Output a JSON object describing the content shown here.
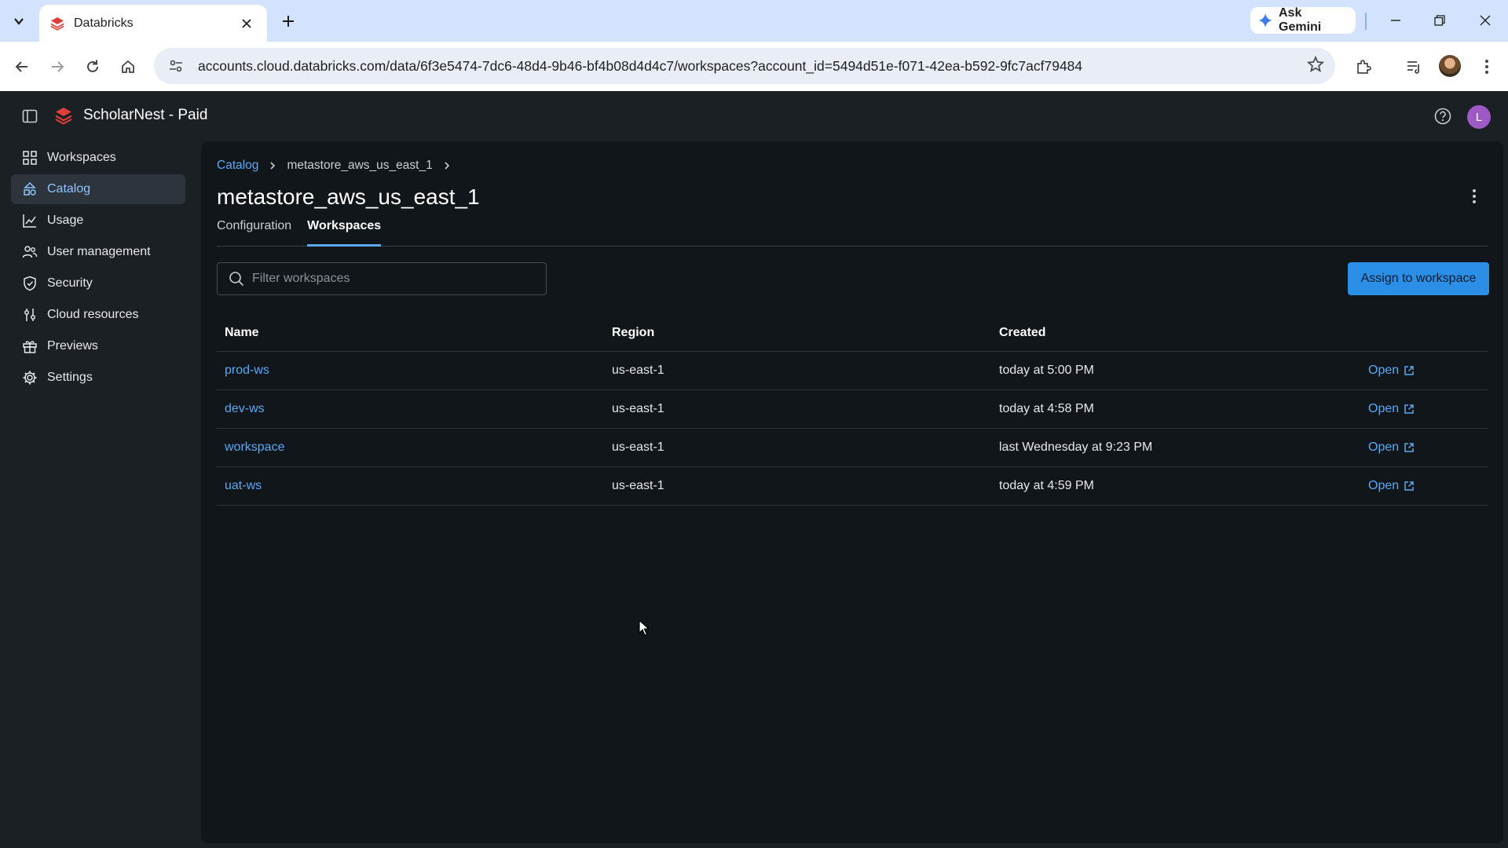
{
  "browser": {
    "tab_title": "Databricks",
    "gemini_label": "Ask Gemini",
    "url": "accounts.cloud.databricks.com/data/6f3e5474-7dc6-48d4-9b46-bf4b08d4d4c7/workspaces?account_id=5494d51e-f071-42ea-b592-9fc7acf79484"
  },
  "app": {
    "account_title": "ScholarNest - Paid",
    "avatar_letter": "L",
    "accent_color": "#5aa8f5",
    "brand_color": "#e0403a"
  },
  "sidebar": {
    "items": [
      {
        "label": "Workspaces",
        "icon": "workspaces-icon"
      },
      {
        "label": "Catalog",
        "icon": "catalog-icon",
        "active": true
      },
      {
        "label": "Usage",
        "icon": "chart-icon"
      },
      {
        "label": "User management",
        "icon": "users-icon"
      },
      {
        "label": "Security",
        "icon": "shield-icon"
      },
      {
        "label": "Cloud resources",
        "icon": "sliders-icon"
      },
      {
        "label": "Previews",
        "icon": "gift-icon"
      },
      {
        "label": "Settings",
        "icon": "gear-icon"
      }
    ]
  },
  "breadcrumb": {
    "root": "Catalog",
    "current": "metastore_aws_us_east_1"
  },
  "page": {
    "title": "metastore_aws_us_east_1",
    "tabs": [
      "Configuration",
      "Workspaces"
    ],
    "active_tab": "Workspaces"
  },
  "filter": {
    "placeholder": "Filter workspaces"
  },
  "assign_button": "Assign to workspace",
  "table": {
    "headers": [
      "Name",
      "Region",
      "Created"
    ],
    "open_label": "Open",
    "rows": [
      {
        "name": "prod-ws",
        "region": "us-east-1",
        "created": "today at 5:00 PM"
      },
      {
        "name": "dev-ws",
        "region": "us-east-1",
        "created": "today at 4:58 PM"
      },
      {
        "name": "workspace",
        "region": "us-east-1",
        "created": "last Wednesday at 9:23 PM"
      },
      {
        "name": "uat-ws",
        "region": "us-east-1",
        "created": "today at 4:59 PM"
      }
    ]
  }
}
